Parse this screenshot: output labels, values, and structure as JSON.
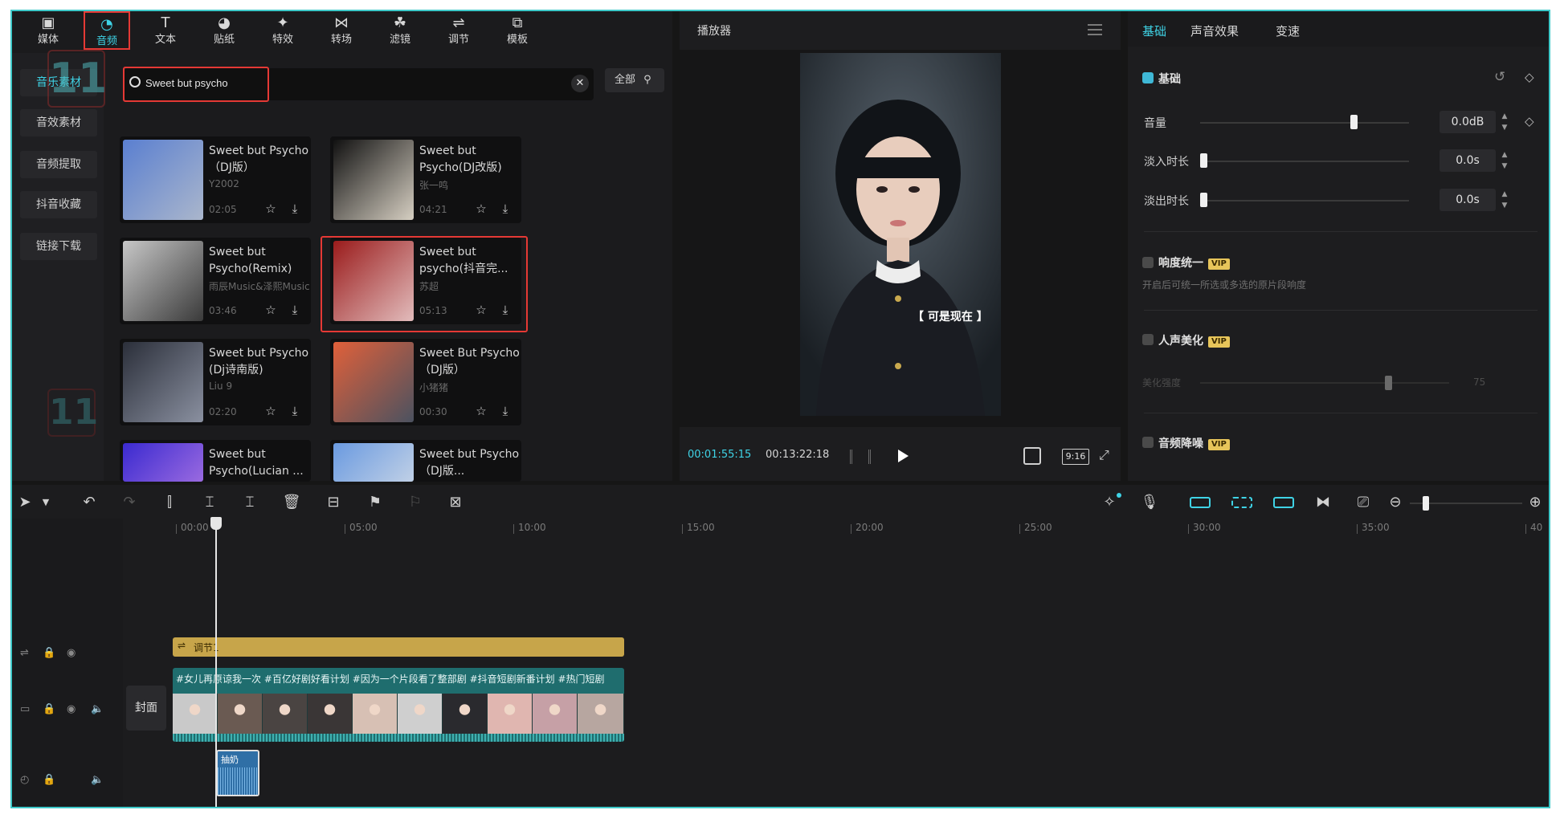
{
  "toolbar": {
    "tools": [
      {
        "label": "媒体",
        "icon": "media-icon"
      },
      {
        "label": "音频",
        "icon": "audio-icon"
      },
      {
        "label": "文本",
        "icon": "text-icon"
      },
      {
        "label": "贴纸",
        "icon": "sticker-icon"
      },
      {
        "label": "特效",
        "icon": "effects-icon"
      },
      {
        "label": "转场",
        "icon": "transition-icon"
      },
      {
        "label": "滤镜",
        "icon": "filter-icon"
      },
      {
        "label": "调节",
        "icon": "adjust-icon"
      },
      {
        "label": "模板",
        "icon": "template-icon"
      }
    ],
    "active": "音频"
  },
  "sidebar": {
    "items": [
      {
        "label": "音乐素材"
      },
      {
        "label": "音效素材"
      },
      {
        "label": "音频提取"
      },
      {
        "label": "抖音收藏"
      },
      {
        "label": "链接下载"
      }
    ]
  },
  "watermark": {
    "text": "11"
  },
  "search": {
    "value": "Sweet but psycho",
    "filter_label": "全部"
  },
  "cards": [
    {
      "title": "Sweet but Psycho（DJ版）",
      "artist": "Y2002",
      "duration": "02:05",
      "colors": [
        "#5a7fd0",
        "#aab6cc"
      ]
    },
    {
      "title": "Sweet but Psycho(DJ改版)",
      "artist": "张一鸣",
      "duration": "04:21",
      "colors": [
        "#111111",
        "#d6cfc2"
      ]
    },
    {
      "title": "Sweet but Psycho(Remix)",
      "artist": "雨辰Music&泽熙Music",
      "duration": "03:46",
      "colors": [
        "#c7c7c7",
        "#3a3a3a"
      ]
    },
    {
      "title": "Sweet but psycho(抖音完...",
      "artist": "苏超",
      "duration": "05:13",
      "colors": [
        "#9a1b1b",
        "#e2bcbc"
      ]
    },
    {
      "title": "Sweet but Psycho (Dj诗南版)",
      "artist": "Liu 9",
      "duration": "02:20",
      "colors": [
        "#2b2f3a",
        "#8a90a0"
      ]
    },
    {
      "title": "Sweet But Psycho（DJ版）",
      "artist": "小猪猪",
      "duration": "00:30",
      "colors": [
        "#e0603a",
        "#4b5260"
      ]
    },
    {
      "title": "Sweet but Psycho(Lucian ...",
      "artist": "",
      "duration": "",
      "colors": [
        "#3a2ad0",
        "#9a6ae0"
      ]
    },
    {
      "title": "Sweet but Psycho（DJ版...",
      "artist": "",
      "duration": "",
      "colors": [
        "#6a9ae0",
        "#c0d0e6"
      ]
    }
  ],
  "player": {
    "title": "播放器",
    "caption": "【 可是现在 】",
    "current_time": "00:01:55:15",
    "total_time": "00:13:22:18",
    "ratio": "9:16"
  },
  "right_panel": {
    "tabs": [
      {
        "label": "基础"
      },
      {
        "label": "声音效果"
      },
      {
        "label": "变速"
      }
    ],
    "section": "基础",
    "rows": [
      {
        "label": "音量",
        "value": "0.0dB",
        "level": 0.72
      },
      {
        "label": "淡入时长",
        "value": "0.0s",
        "level": 0.0
      },
      {
        "label": "淡出时长",
        "value": "0.0s",
        "level": 0.0
      }
    ],
    "loudness": {
      "label": "响度统一",
      "badge": "VIP",
      "desc": "开启后可统一所选或多选的原片段响度"
    },
    "voice": {
      "label": "人声美化",
      "badge": "VIP",
      "strength_label": "美化强度",
      "strength_value": "75"
    },
    "denoise": {
      "label": "音频降噪",
      "badge": "VIP"
    }
  },
  "timeline": {
    "ticks": [
      "00:00",
      "05:00",
      "10:00",
      "15:00",
      "20:00",
      "25:00",
      "30:00",
      "35:00",
      "40"
    ],
    "adjust_clip": "调节1",
    "cover_label": "封面",
    "video_text": "#女儿再原谅我一次 #百亿好剧好看计划 #因为一个片段看了整部剧 #抖音短剧新番计划 #热门短剧",
    "audio_clip": "抽奶",
    "playhead_position": 0.031
  },
  "colors": {
    "accent": "#3fd3e6",
    "highlight": "#e53935",
    "adjust_clip": "#c7a54a",
    "video_track": "#1f6d6e"
  }
}
